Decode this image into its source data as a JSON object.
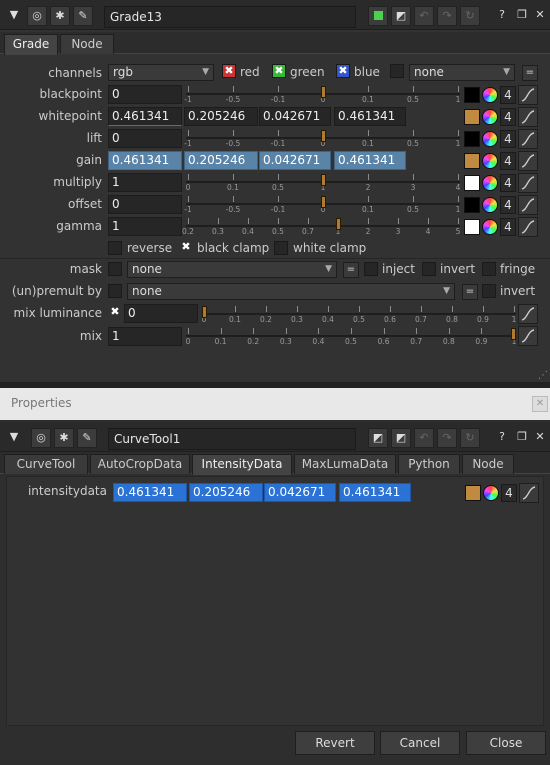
{
  "grade_panel": {
    "node_name": "Grade13",
    "tabs": [
      "Grade",
      "Node"
    ],
    "channels": {
      "label": "channels",
      "value": "rgb",
      "red": "red",
      "green": "green",
      "blue": "blue",
      "extra": "none"
    },
    "rows": {
      "blackpoint": {
        "label": "blackpoint",
        "values": [
          "0"
        ],
        "ticks": [
          "-1",
          "-0.5",
          "-0.1",
          "0",
          "0.1",
          "0.5",
          "1"
        ],
        "handle": 0
      },
      "whitepoint": {
        "label": "whitepoint",
        "values": [
          "0.461341",
          "0.205246",
          "0.042671",
          "0.461341"
        ]
      },
      "lift": {
        "label": "lift",
        "values": [
          "0"
        ],
        "ticks": [
          "-1",
          "-0.5",
          "-0.1",
          "0",
          "0.1",
          "0.5",
          "1"
        ],
        "handle": 0
      },
      "gain": {
        "label": "gain",
        "values": [
          "0.461341",
          "0.205246",
          "0.042671",
          "0.461341"
        ]
      },
      "multiply": {
        "label": "multiply",
        "values": [
          "1"
        ],
        "ticks": [
          "0",
          "0.1",
          "0.5",
          "1",
          "2",
          "3",
          "4"
        ],
        "handle": 1
      },
      "offset": {
        "label": "offset",
        "values": [
          "0"
        ],
        "ticks": [
          "-1",
          "-0.5",
          "-0.1",
          "0",
          "0.1",
          "0.5",
          "1"
        ],
        "handle": 0
      },
      "gamma": {
        "label": "gamma",
        "values": [
          "1"
        ],
        "ticks": [
          "0.2",
          "0.3",
          "0.4",
          "0.5",
          "0.7",
          "1",
          "2",
          "3",
          "4",
          "5"
        ],
        "handle": 1
      }
    },
    "count": "4",
    "reverse": "reverse",
    "black_clamp": "black clamp",
    "white_clamp": "white clamp",
    "mask": {
      "label": "mask",
      "value": "none",
      "inject": "inject",
      "invert": "invert",
      "fringe": "fringe"
    },
    "unpremult": {
      "label": "(un)premult by",
      "value": "none",
      "invert": "invert"
    },
    "mix_luminance": {
      "label": "mix luminance",
      "value": "0",
      "ticks": [
        "0",
        "0.1",
        "0.2",
        "0.3",
        "0.4",
        "0.5",
        "0.6",
        "0.7",
        "0.8",
        "0.9",
        "1"
      ]
    },
    "mix": {
      "label": "mix",
      "value": "1",
      "ticks": [
        "0",
        "0.1",
        "0.2",
        "0.3",
        "0.4",
        "0.5",
        "0.6",
        "0.7",
        "0.8",
        "0.9",
        "1"
      ]
    }
  },
  "properties_title": "Properties",
  "curve_panel": {
    "node_name": "CurveTool1",
    "tabs": [
      "CurveTool",
      "AutoCropData",
      "IntensityData",
      "MaxLumaData",
      "Python",
      "Node"
    ],
    "active_tab": "IntensityData",
    "intensitydata": {
      "label": "intensitydata",
      "values": [
        "0.461341",
        "0.205246",
        "0.042671",
        "0.461341"
      ]
    },
    "count": "4"
  },
  "buttons": {
    "revert": "Revert",
    "cancel": "Cancel",
    "close": "Close"
  },
  "colors": {
    "accent": "#5a83a8",
    "selected_field": "#2a72d4",
    "swatch_gain": "#c08a40",
    "handle": "#b07a30"
  },
  "icons": [
    "collapse-arrow-icon",
    "viewer-icon",
    "bug-icon",
    "wrench-icon",
    "help-icon",
    "float-icon",
    "close-icon",
    "undo-icon",
    "redo-icon",
    "color-wheel-icon",
    "curve-icon"
  ]
}
